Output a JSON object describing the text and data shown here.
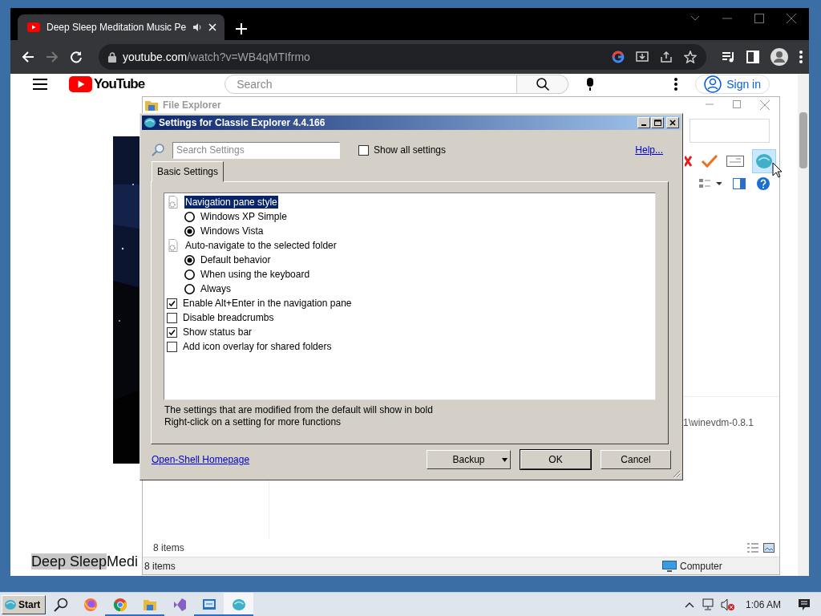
{
  "browser": {
    "tab": {
      "title": "Deep Sleep Meditation Music Pe"
    },
    "address": {
      "host": "youtube.com",
      "path": "/watch?v=WB4qMTIfrmo"
    },
    "youtube": {
      "logo": "YouTube",
      "search": {
        "placeholder": "Search"
      },
      "sign_in": "Sign in",
      "video_title": [
        {
          "text": "Deep Sleep",
          "highlighted": true
        },
        {
          "text": "Medi",
          "highlighted": false
        }
      ]
    }
  },
  "file_explorer": {
    "title": "File Explorer",
    "list_item": "1\\winevdm-0.8.1",
    "item_count": "8 items",
    "status_bar": {
      "items": "8 items",
      "location": "Computer"
    }
  },
  "dialog": {
    "title": "Settings for Classic Explorer 4.4.166",
    "search": {
      "placeholder": "Search Settings"
    },
    "show_all": {
      "label": "Show all settings",
      "checked": false
    },
    "help_link": "Help...",
    "tabs": [
      {
        "label": "Basic Settings",
        "selected": true
      }
    ],
    "settings": [
      {
        "kind": "group",
        "label": "Navigation pane style",
        "selected": true,
        "children": [
          {
            "kind": "radio",
            "label": "Windows XP Simple",
            "checked": false,
            "selected": false
          },
          {
            "kind": "radio",
            "label": "Windows Vista",
            "checked": true,
            "selected": false
          }
        ]
      },
      {
        "kind": "group",
        "label": "Auto-navigate to the selected folder",
        "selected": false,
        "children": [
          {
            "kind": "radio",
            "label": "Default behavior",
            "checked": true,
            "selected": false
          },
          {
            "kind": "radio",
            "label": "When using the keyboard",
            "checked": false,
            "selected": false
          },
          {
            "kind": "radio",
            "label": "Always",
            "checked": false,
            "selected": false
          }
        ]
      },
      {
        "kind": "checkbox",
        "label": "Enable Alt+Enter in the navigation pane",
        "checked": true,
        "selected": false
      },
      {
        "kind": "checkbox",
        "label": "Disable breadcrumbs",
        "checked": false,
        "selected": false
      },
      {
        "kind": "checkbox",
        "label": "Show status bar",
        "checked": true,
        "selected": false
      },
      {
        "kind": "checkbox",
        "label": "Add icon overlay for shared folders",
        "checked": false,
        "selected": false
      }
    ],
    "notes": [
      "The settings that are modified from the default will show in bold",
      "Right-click on a setting for more functions"
    ],
    "homepage_link": "Open-Shell Homepage",
    "buttons": [
      {
        "label": "Backup",
        "kind": "menu"
      },
      {
        "label": "OK",
        "kind": "default"
      },
      {
        "label": "Cancel",
        "kind": "normal"
      }
    ]
  },
  "taskbar": {
    "start": "Start",
    "apps": [
      {
        "kind": "firefox",
        "running": false,
        "active": false
      },
      {
        "kind": "chrome",
        "running": true,
        "active": false
      },
      {
        "kind": "folder",
        "running": true,
        "active": false
      },
      {
        "kind": "studio",
        "running": false,
        "active": false
      },
      {
        "kind": "monitor",
        "running": true,
        "active": false
      },
      {
        "kind": "shell",
        "running": true,
        "active": true
      }
    ],
    "clock": "1:06 AM"
  }
}
